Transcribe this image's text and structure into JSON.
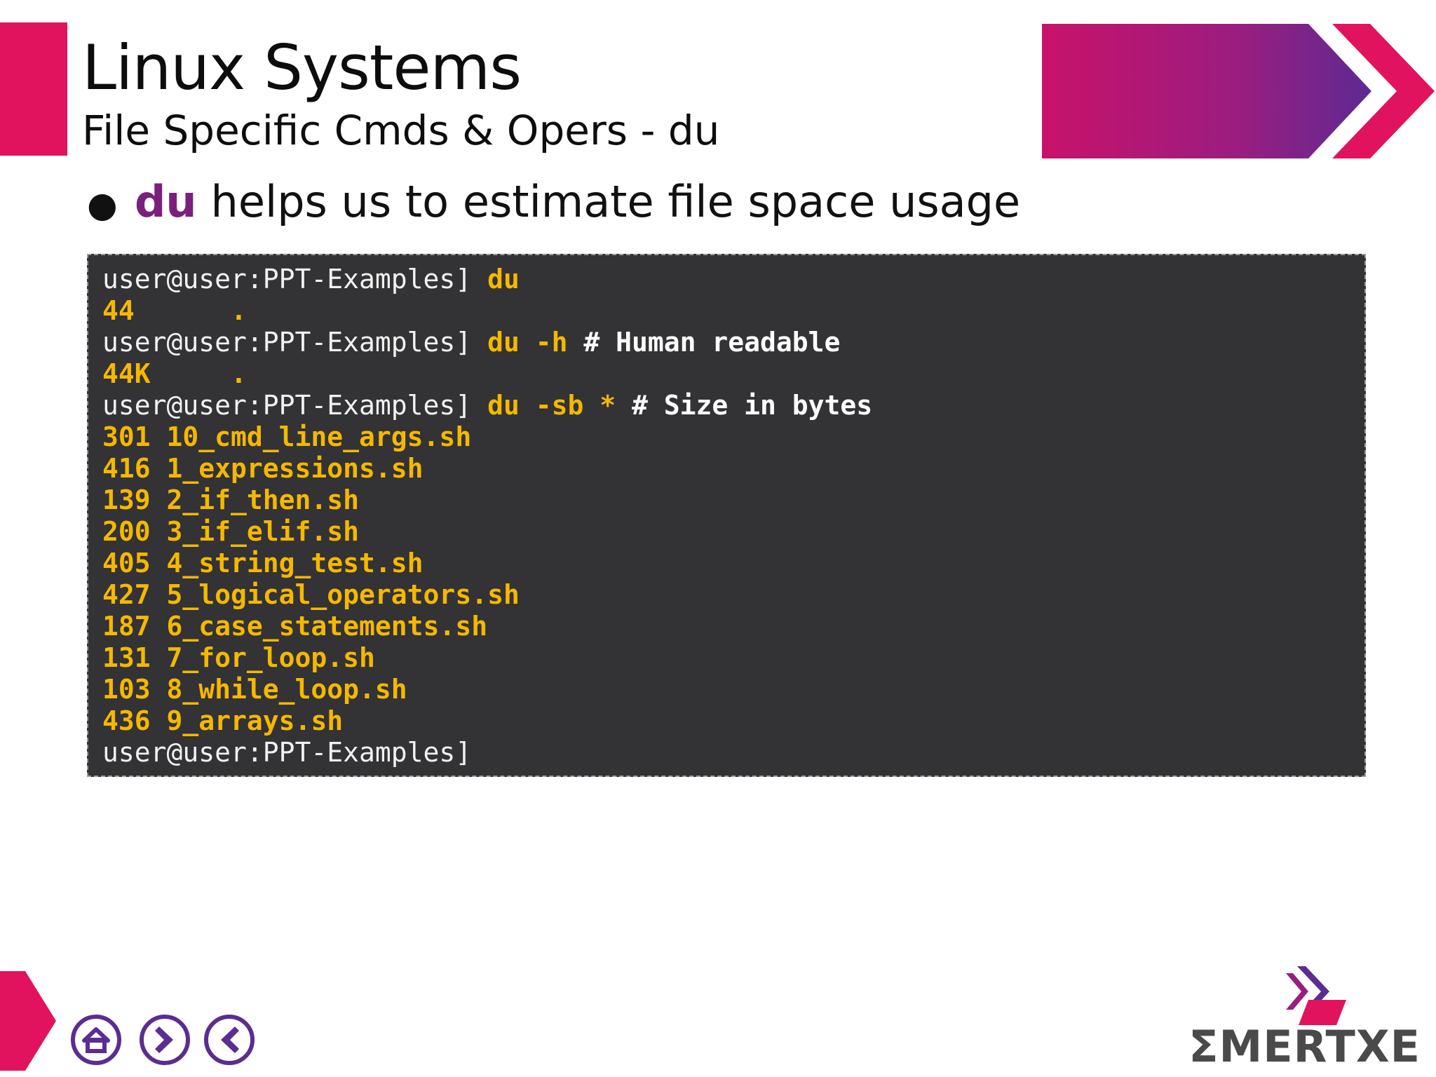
{
  "slide": {
    "title": "Linux Systems",
    "subtitle": "File Specific Cmds & Opers - du",
    "bullet": {
      "keyword": "du",
      "text": "helps us to estimate file space usage"
    }
  },
  "terminal": {
    "lines": [
      {
        "prompt": "user@user:PPT-Examples]",
        "command": "du",
        "comment": ""
      },
      {
        "output": "44      ."
      },
      {
        "prompt": "user@user:PPT-Examples]",
        "command": "du -h",
        "comment": "# Human readable"
      },
      {
        "output": "44K     ."
      },
      {
        "prompt": "user@user:PPT-Examples]",
        "command": "du -sb *",
        "comment": "# Size in bytes"
      },
      {
        "output": "301 10_cmd_line_args.sh"
      },
      {
        "output": "416 1_expressions.sh"
      },
      {
        "output": "139 2_if_then.sh"
      },
      {
        "output": "200 3_if_elif.sh"
      },
      {
        "output": "405 4_string_test.sh"
      },
      {
        "output": "427 5_logical_operators.sh"
      },
      {
        "output": "187 6_case_statements.sh"
      },
      {
        "output": "131 7_for_loop.sh"
      },
      {
        "output": "103 8_while_loop.sh"
      },
      {
        "output": "436 9_arrays.sh"
      },
      {
        "prompt": "user@user:PPT-Examples]",
        "command": "",
        "comment": ""
      }
    ]
  },
  "navigation": [
    {
      "name": "home-button",
      "icon": "home-icon"
    },
    {
      "name": "next-button",
      "icon": "chevron-right-icon"
    },
    {
      "name": "previous-button",
      "icon": "chevron-left-icon"
    }
  ],
  "logo": {
    "text": "ΣMERTXE"
  },
  "colors": {
    "accent_pink": "#e2135e",
    "accent_purple": "#5b2d91",
    "keyword_purple": "#7b1f7d",
    "terminal_bg": "#333235",
    "terminal_highlight": "#f5b800"
  }
}
